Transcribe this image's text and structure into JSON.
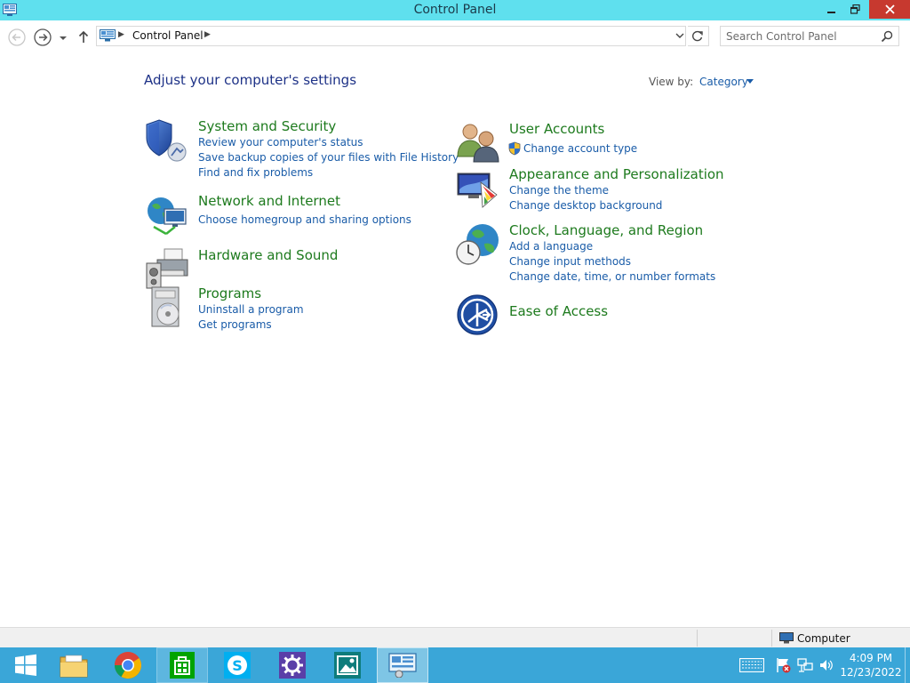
{
  "window": {
    "title": "Control Panel",
    "titlebar_color": "#5fe0ee",
    "close_color": "#c7392f"
  },
  "nav": {
    "breadcrumb": "Control Panel",
    "search_placeholder": "Search Control Panel"
  },
  "content": {
    "heading": "Adjust your computer's settings",
    "view_by_label": "View by:",
    "view_by_value": "Category",
    "categories": [
      {
        "title": "System and Security",
        "icon": "shield-icon",
        "links": [
          "Review your computer's status",
          "Save backup copies of your files with File History",
          "Find and fix problems"
        ]
      },
      {
        "title": "Network and Internet",
        "icon": "network-globe-icon",
        "links": [
          "Choose homegroup and sharing options"
        ]
      },
      {
        "title": "Hardware and Sound",
        "icon": "printer-speaker-icon",
        "links": []
      },
      {
        "title": "Programs",
        "icon": "programs-disc-icon",
        "links": [
          "Uninstall a program",
          "Get programs"
        ]
      },
      {
        "title": "User Accounts",
        "icon": "users-icon",
        "links": [
          "Change account type"
        ]
      },
      {
        "title": "Appearance and Personalization",
        "icon": "monitor-palette-icon",
        "links": [
          "Change the theme",
          "Change desktop background"
        ]
      },
      {
        "title": "Clock, Language, and Region",
        "icon": "clock-globe-icon",
        "links": [
          "Add a language",
          "Change input methods",
          "Change date, time, or number formats"
        ]
      },
      {
        "title": "Ease of Access",
        "icon": "ease-of-access-icon",
        "links": []
      }
    ]
  },
  "statusbar": {
    "location": "Computer"
  },
  "taskbar": {
    "color": "#3aa6d8",
    "apps": [
      "start-icon",
      "file-explorer-icon",
      "chrome-icon",
      "store-icon",
      "skype-icon",
      "settings-app-icon",
      "photos-icon",
      "control-panel-icon"
    ],
    "time": "4:09 PM",
    "date": "12/23/2022"
  }
}
